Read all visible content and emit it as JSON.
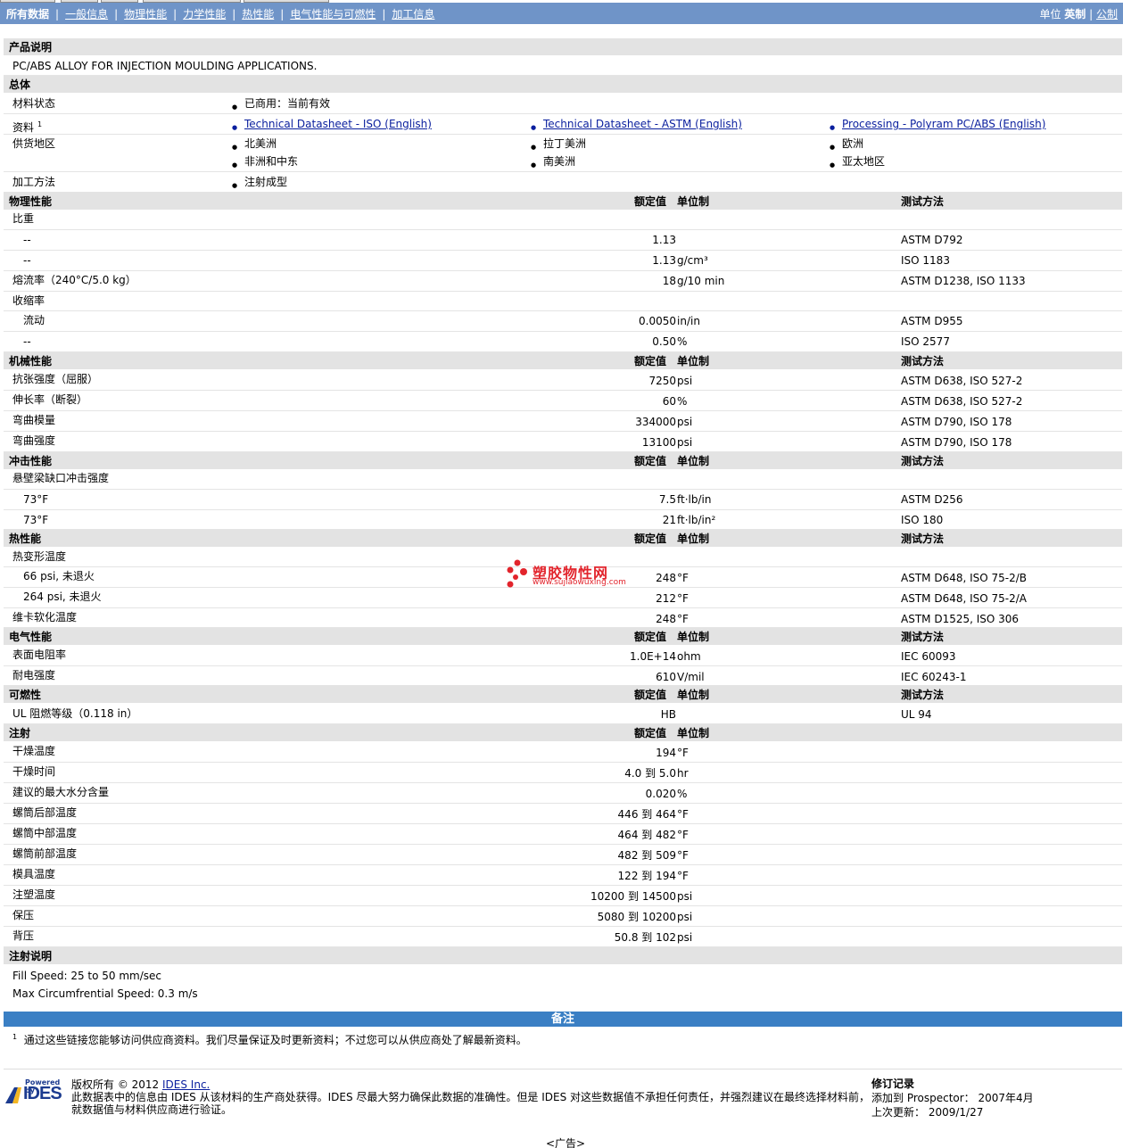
{
  "nav": {
    "all_data": "所有数据",
    "links": [
      "一般信息",
      "物理性能",
      "力学性能",
      "热性能",
      "电气性能与可燃性",
      "加工信息"
    ],
    "units_label": "单位",
    "units_current": "英制",
    "units_other": "公制"
  },
  "product": {
    "heading": "产品说明",
    "description": "PC/ABS ALLOY FOR INJECTION MOULDING APPLICATIONS."
  },
  "general": {
    "heading": "总体",
    "status_label": "材料状态",
    "status_value": "已商用：当前有效",
    "docs_label": "资料",
    "docs_footnote": "1",
    "docs": [
      "Technical Datasheet - ISO (English)",
      "Technical Datasheet - ASTM (English)",
      "Processing - Polyram PC/ABS (English)"
    ],
    "regions_label": "供货地区",
    "regions": [
      "北美洲",
      "拉丁美洲",
      "欧洲",
      "非洲和中东",
      "南美洲",
      "亚太地区"
    ],
    "method_label": "加工方法",
    "method_value": "注射成型"
  },
  "col_headers": {
    "value": "额定值",
    "unit": "单位制",
    "test": "测试方法"
  },
  "physical": {
    "heading": "物理性能",
    "specific_gravity": "比重",
    "sg_rows": [
      {
        "label": "--",
        "value": "1.13",
        "unit": "",
        "test": "ASTM D792"
      },
      {
        "label": "--",
        "value": "1.13",
        "unit": "g/cm³",
        "test": "ISO 1183"
      }
    ],
    "mfr": {
      "label": "熔流率（240°C/5.0 kg）",
      "value": "18",
      "unit": "g/10 min",
      "test": "ASTM D1238, ISO 1133"
    },
    "shrinkage": "收缩率",
    "shrink_rows": [
      {
        "label": "流动",
        "value": "0.0050",
        "unit": "in/in",
        "test": "ASTM D955"
      },
      {
        "label": "--",
        "value": "0.50",
        "unit": "%",
        "test": "ISO 2577"
      }
    ]
  },
  "mechanical": {
    "heading": "机械性能",
    "rows": [
      {
        "label": "抗张强度（屈服）",
        "value": "7250",
        "unit": "psi",
        "test": "ASTM D638, ISO 527-2"
      },
      {
        "label": "伸长率（断裂）",
        "value": "60",
        "unit": "%",
        "test": "ASTM D638, ISO 527-2"
      },
      {
        "label": "弯曲模量",
        "value": "334000",
        "unit": "psi",
        "test": "ASTM D790, ISO 178"
      },
      {
        "label": "弯曲强度",
        "value": "13100",
        "unit": "psi",
        "test": "ASTM D790, ISO 178"
      }
    ]
  },
  "impact": {
    "heading": "冲击性能",
    "sub": "悬壁梁缺口冲击强度",
    "rows": [
      {
        "label": "73°F",
        "value": "7.5",
        "unit": "ft·lb/in",
        "test": "ASTM D256"
      },
      {
        "label": "73°F",
        "value": "21",
        "unit": "ft·lb/in²",
        "test": "ISO 180"
      }
    ]
  },
  "thermal": {
    "heading": "热性能",
    "sub": "热变形温度",
    "rows": [
      {
        "label": "66 psi, 未退火",
        "value": "248",
        "unit": "°F",
        "test": "ASTM D648, ISO 75-2/B"
      },
      {
        "label": "264 psi, 未退火",
        "value": "212",
        "unit": "°F",
        "test": "ASTM D648, ISO 75-2/A"
      }
    ],
    "vicat": {
      "label": "维卡软化温度",
      "value": "248",
      "unit": "°F",
      "test": "ASTM D1525, ISO 306"
    }
  },
  "electrical": {
    "heading": "电气性能",
    "rows": [
      {
        "label": "表面电阻率",
        "value": "1.0E+14",
        "unit": "ohm",
        "test": "IEC 60093"
      },
      {
        "label": "耐电强度",
        "value": "610",
        "unit": "V/mil",
        "test": "IEC 60243-1"
      }
    ]
  },
  "flammability": {
    "heading": "可燃性",
    "rows": [
      {
        "label": "UL 阻燃等级（0.118 in）",
        "value": "HB",
        "unit": "",
        "test": "UL 94"
      }
    ]
  },
  "injection": {
    "heading": "注射",
    "rows": [
      {
        "label": "干燥温度",
        "value": "194",
        "unit": "°F"
      },
      {
        "label": "干燥时间",
        "value": "4.0 到  5.0",
        "unit": "hr"
      },
      {
        "label": "建议的最大水分含量",
        "value": "0.020",
        "unit": "%"
      },
      {
        "label": "螺筒后部温度",
        "value": "446 到  464",
        "unit": "°F"
      },
      {
        "label": "螺筒中部温度",
        "value": "464 到  482",
        "unit": "°F"
      },
      {
        "label": "螺筒前部温度",
        "value": "482 到  509",
        "unit": "°F"
      },
      {
        "label": "模具温度",
        "value": "122 到  194",
        "unit": "°F"
      },
      {
        "label": "注塑温度",
        "value": "10200 到  14500",
        "unit": "psi"
      },
      {
        "label": "保压",
        "value": "5080 到  10200",
        "unit": "psi"
      },
      {
        "label": "背压",
        "value": "50.8 到  102",
        "unit": "psi"
      }
    ]
  },
  "injection_notes": {
    "heading": "注射说明",
    "lines": [
      "Fill Speed: 25 to 50 mm/sec",
      "Max Circumfrential Speed: 0.3 m/s"
    ]
  },
  "notes": {
    "heading": "备注",
    "footnote_num": "1",
    "footnote": "通过这些链接您能够访问供应商资料。我们尽量保证及时更新资料；不过您可以从供应商处了解最新资料。"
  },
  "footer": {
    "logo_powered": "Powered by",
    "logo_name": "IDES",
    "copyright": "版权所有 © 2012",
    "company": "IDES Inc.",
    "disclaimer1": "此数据表中的信息由 IDES 从该材料的生产商处获得。IDES 尽最大努力确保此数据的准确性。但是 IDES 对这些数据值不承担任何责任，并强烈建议在最终选择材料前，",
    "disclaimer2": "就数据值与材料供应商进行验证。",
    "revision_title": "修订记录",
    "added_to": "添加到 Prospector： 2007年4月",
    "last_update": "上次更新： 2009/1/27",
    "ad": "<广告>"
  },
  "watermark": {
    "title": "塑胶物性网",
    "url": "www.sujiaowuxing.com"
  }
}
